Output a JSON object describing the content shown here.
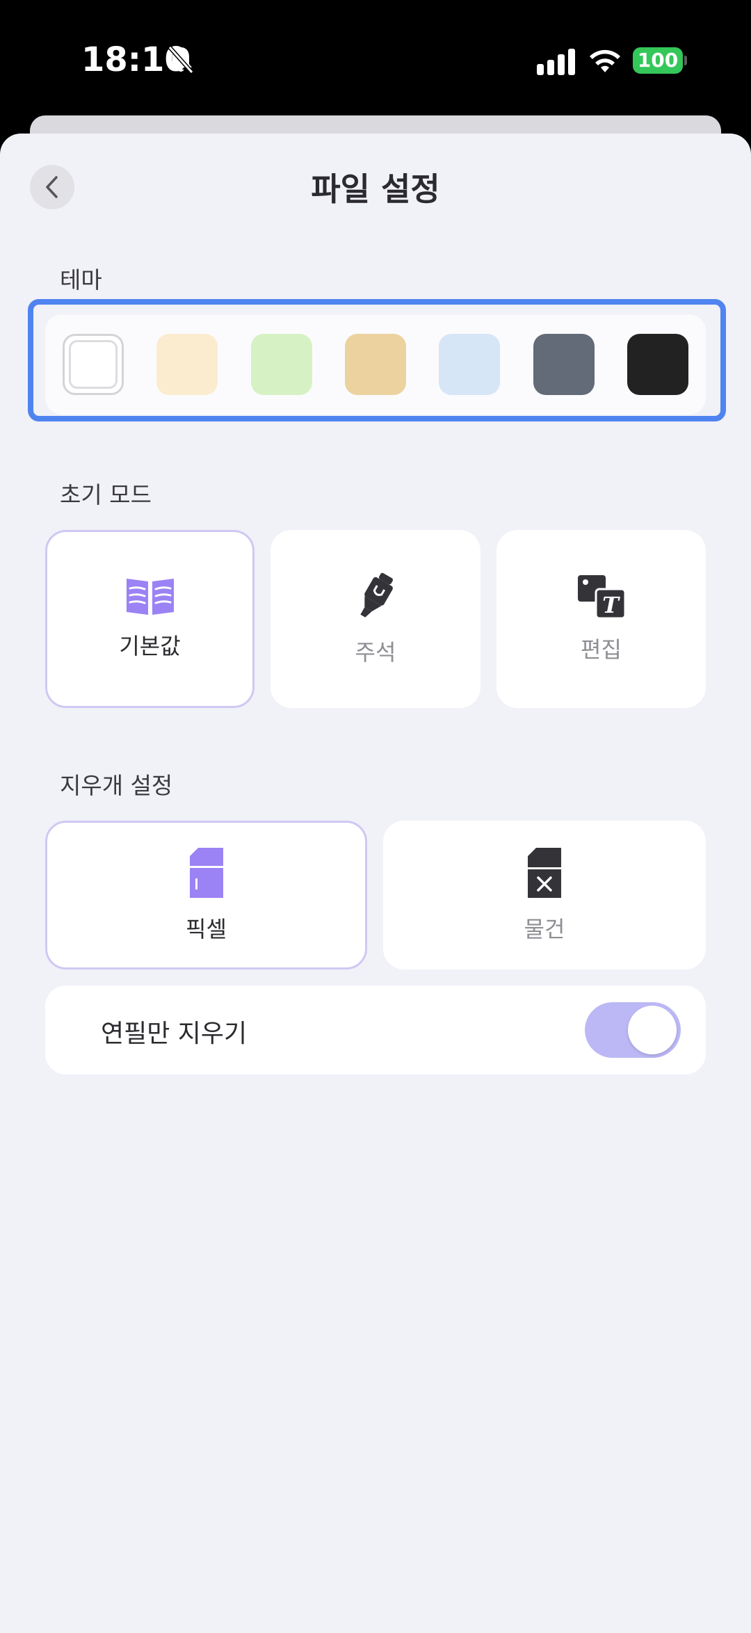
{
  "status": {
    "time": "18:10",
    "battery": "100"
  },
  "header": {
    "title": "파일 설정"
  },
  "theme": {
    "label": "테마",
    "swatches": [
      {
        "name": "white",
        "color": "#ffffff",
        "selected": true
      },
      {
        "name": "cream",
        "color": "#fbecd0",
        "selected": false
      },
      {
        "name": "light-green",
        "color": "#d6f2c4",
        "selected": false
      },
      {
        "name": "tan",
        "color": "#ecd29e",
        "selected": false
      },
      {
        "name": "light-blue",
        "color": "#d6e6f7",
        "selected": false
      },
      {
        "name": "slate",
        "color": "#636a78",
        "selected": false
      },
      {
        "name": "black",
        "color": "#222222",
        "selected": false
      }
    ]
  },
  "initial_mode": {
    "label": "초기 모드",
    "options": [
      {
        "label": "기본값",
        "icon": "book-icon",
        "selected": true
      },
      {
        "label": "주석",
        "icon": "highlighter-icon",
        "selected": false
      },
      {
        "label": "편집",
        "icon": "image-text-icon",
        "selected": false
      }
    ]
  },
  "eraser": {
    "label": "지우개 설정",
    "options": [
      {
        "label": "픽셀",
        "icon": "pixel-eraser-icon",
        "selected": true
      },
      {
        "label": "물건",
        "icon": "object-eraser-icon",
        "selected": false
      }
    ],
    "toggle_label": "연필만 지우기",
    "toggle_on": true
  },
  "colors": {
    "accent": "#9b82f5",
    "highlight_border": "#4f84f0",
    "toggle_on": "#bcb8f6"
  }
}
